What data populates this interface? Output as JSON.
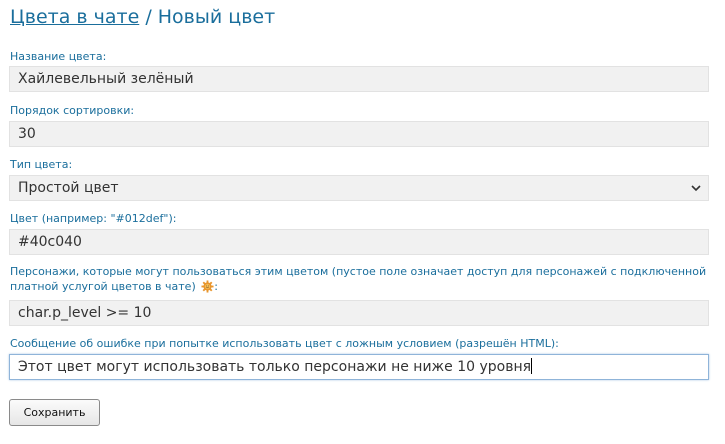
{
  "breadcrumb": {
    "parent": "Цвета в чате",
    "separator": "/",
    "current": "Новый цвет"
  },
  "form": {
    "name": {
      "label": "Название цвета:",
      "value": "Хайлевельный зелёный"
    },
    "sort_order": {
      "label": "Порядок сортировки:",
      "value": "30"
    },
    "color_type": {
      "label": "Тип цвета:",
      "selected": "Простой цвет"
    },
    "color": {
      "label": "Цвет (например: \"#012def\"):",
      "value": "#40c040"
    },
    "characters": {
      "label": "Персонажи, которые могут пользоваться этим цветом (пустое поле означает доступ для персонажей с подключенной платной услугой цветов в чате)",
      "label_suffix": ":",
      "value": "char.p_level >= 10"
    },
    "error_message": {
      "label": "Сообщение об ошибке при попытке использовать цвет с ложным условием (разрешён HTML):",
      "value": "Этот цвет могут использовать только персонажи не ниже 10 уровня"
    },
    "submit_label": "Сохранить"
  },
  "colors": {
    "accent": "#1a6e9c",
    "field_bg": "#f1f1f1",
    "help_icon": "#e8962e"
  }
}
